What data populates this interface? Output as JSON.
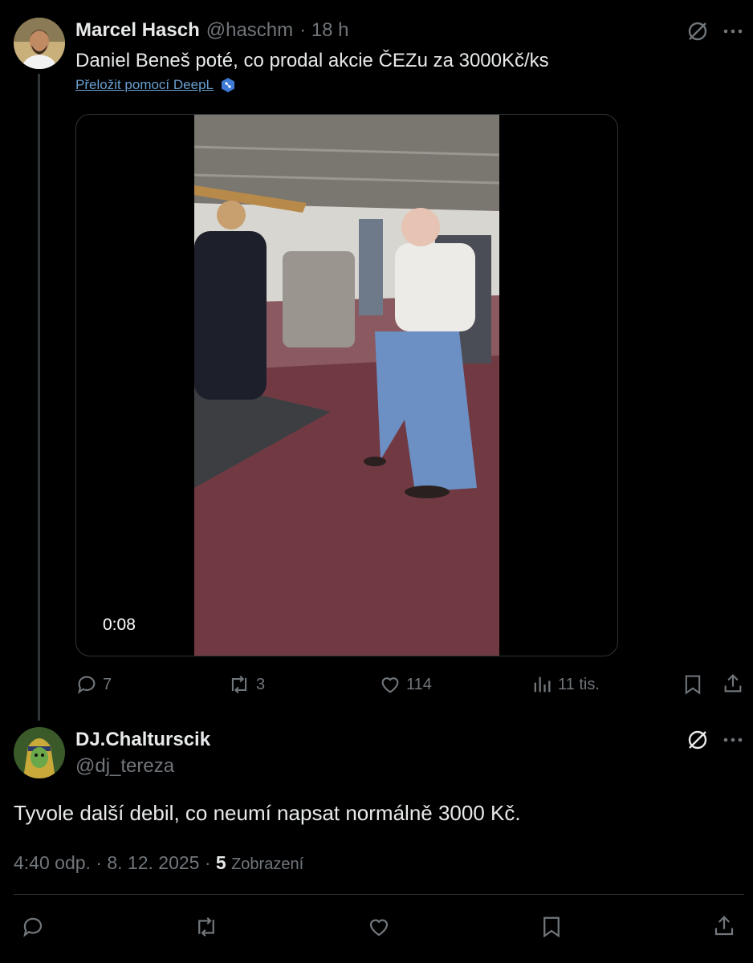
{
  "tweet": {
    "author_name": "Marcel Hasch",
    "author_handle": "@haschm",
    "time_ago": "· 18 h",
    "text": "Daniel Beneš poté, co prodal akcie ČEZu  za 3000Kč/ks",
    "translate_link": "Přeložit pomocí DeepL",
    "video_duration": "0:08",
    "stats": {
      "replies": "7",
      "reposts": "3",
      "likes": "114",
      "views": "11 tis."
    },
    "icons": [
      "grok-icon",
      "more-icon",
      "reply-icon",
      "repost-icon",
      "like-icon",
      "views-icon",
      "bookmark-icon",
      "share-icon"
    ]
  },
  "reply": {
    "author_name": "DJ.Chalturscik",
    "author_handle": "@dj_tereza",
    "text": "Tyvole další debil, co neumí napsat normálně 3000 Kč.",
    "timestamp": "4:40 odp. · 8. 12. 2025 ·",
    "views_count": "5",
    "views_label": "Zobrazení"
  },
  "colors": {
    "background": "#000000",
    "text": "#e7e9ea",
    "muted": "#71767b",
    "link": "#6a9fd0",
    "border": "#2f3336"
  }
}
